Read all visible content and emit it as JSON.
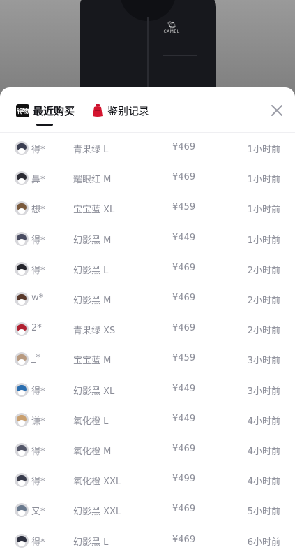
{
  "product_image": {
    "brand": "CAMEL",
    "emblem": "camel-icon"
  },
  "tabs": [
    {
      "label": "最近购买",
      "icon": "dewu-logo-icon",
      "icon_text": "得物",
      "active": true
    },
    {
      "label": "鉴别记录",
      "icon": "auth-badge-icon",
      "active": false
    }
  ],
  "close_icon": "close-icon",
  "purchases": [
    {
      "user": "得*",
      "spec": "青果绿 L",
      "price": "¥469",
      "time": "1小时前",
      "avatar_color": "#3b3f52"
    },
    {
      "user": "鼻*",
      "spec": "耀眼红 M",
      "price": "¥469",
      "time": "1小时前",
      "avatar_color": "#2c2c34"
    },
    {
      "user": "想*",
      "spec": "宝宝蓝 XL",
      "price": "¥459",
      "time": "1小时前",
      "avatar_color": "#7a5a3c"
    },
    {
      "user": "得*",
      "spec": "幻影黑 M",
      "price": "¥449",
      "time": "1小时前",
      "avatar_color": "#4a4d62"
    },
    {
      "user": "得*",
      "spec": "幻影黑 L",
      "price": "¥469",
      "time": "2小时前",
      "avatar_color": "#26272e"
    },
    {
      "user": "w*",
      "spec": "幻影黑 M",
      "price": "¥469",
      "time": "2小时前",
      "avatar_color": "#5a3a2c"
    },
    {
      "user": "2*",
      "spec": "青果绿 XS",
      "price": "¥469",
      "time": "2小时前",
      "avatar_color": "#b02030"
    },
    {
      "user": "_*",
      "spec": "宝宝蓝 M",
      "price": "¥459",
      "time": "3小时前",
      "avatar_color": "#b89a80"
    },
    {
      "user": "得*",
      "spec": "幻影黑 XL",
      "price": "¥449",
      "time": "3小时前",
      "avatar_color": "#2b6fb0"
    },
    {
      "user": "谦*",
      "spec": "氧化橙 L",
      "price": "¥449",
      "time": "4小时前",
      "avatar_color": "#c9a070"
    },
    {
      "user": "得*",
      "spec": "氧化橙 M",
      "price": "¥469",
      "time": "4小时前",
      "avatar_color": "#55586a"
    },
    {
      "user": "得*",
      "spec": "氧化橙 XXL",
      "price": "¥499",
      "time": "4小时前",
      "avatar_color": "#3a3d4e"
    },
    {
      "user": "又*",
      "spec": "幻影黑 XXL",
      "price": "¥469",
      "time": "5小时前",
      "avatar_color": "#6a7a8e"
    },
    {
      "user": "得*",
      "spec": "幻影黑 L",
      "price": "¥469",
      "time": "6小时前",
      "avatar_color": "#2e3140"
    }
  ]
}
